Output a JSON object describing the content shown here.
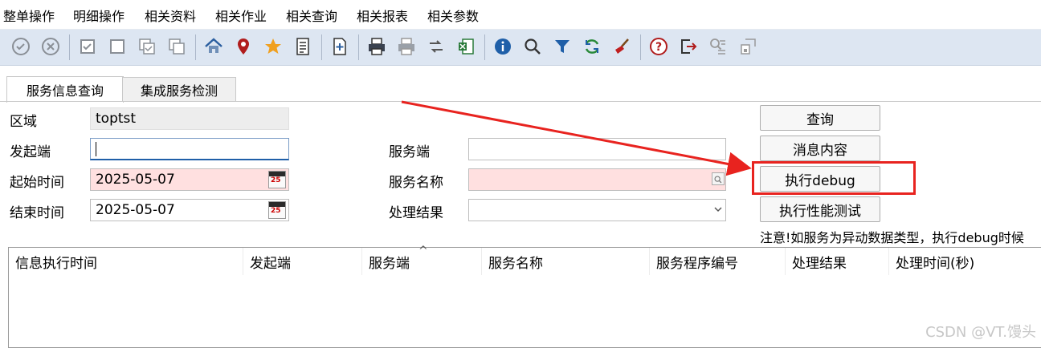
{
  "menu": [
    "整单操作",
    "明细操作",
    "相关资料",
    "相关作业",
    "相关查询",
    "相关报表",
    "相关参数"
  ],
  "toolbar": {
    "icons": [
      "check-circle-icon",
      "cancel-circle-icon",
      "checkbox-icon",
      "square-icon",
      "copy-check-icon",
      "copy-icon",
      "home-icon",
      "map-pin-icon",
      "star-icon",
      "document-list-icon",
      "add-page-icon",
      "print-icon",
      "print-gray-icon",
      "transfer-icon",
      "excel-icon",
      "info-icon",
      "search-icon",
      "filter-icon",
      "refresh-icon",
      "broom-icon",
      "help-icon",
      "exit-icon",
      "search-list-icon",
      "export-icon"
    ]
  },
  "tabs": [
    {
      "label": "服务信息查询",
      "active": true
    },
    {
      "label": "集成服务检测",
      "active": false
    }
  ],
  "form": {
    "region_label": "区域",
    "region_value": "toptst",
    "initiator_label": "发起端",
    "initiator_value": "",
    "start_time_label": "起始时间",
    "start_time_value": "2025-05-07",
    "end_time_label": "结束时间",
    "end_time_value": "2025-05-07",
    "server_label": "服务端",
    "server_value": "",
    "service_name_label": "服务名称",
    "service_name_value": "",
    "result_label": "处理结果",
    "result_value": "",
    "calendar_day": "25"
  },
  "buttons": {
    "query": "查询",
    "message": "消息内容",
    "debug": "执行debug",
    "perf": "执行性能测试"
  },
  "note": "注意!如服务为异动数据类型，执行debug时候",
  "grid": {
    "columns": [
      "信息执行时间",
      "发起端",
      "服务端",
      "服务名称",
      "服务程序编号",
      "处理结果",
      "处理时间(秒)"
    ],
    "sort_indicator": "^"
  },
  "watermark": "CSDN @VT.馒头",
  "colors": {
    "required_bg": "#ffe0e0",
    "annotation": "#e8231f",
    "toolbar_bg": "#dde6f2"
  }
}
